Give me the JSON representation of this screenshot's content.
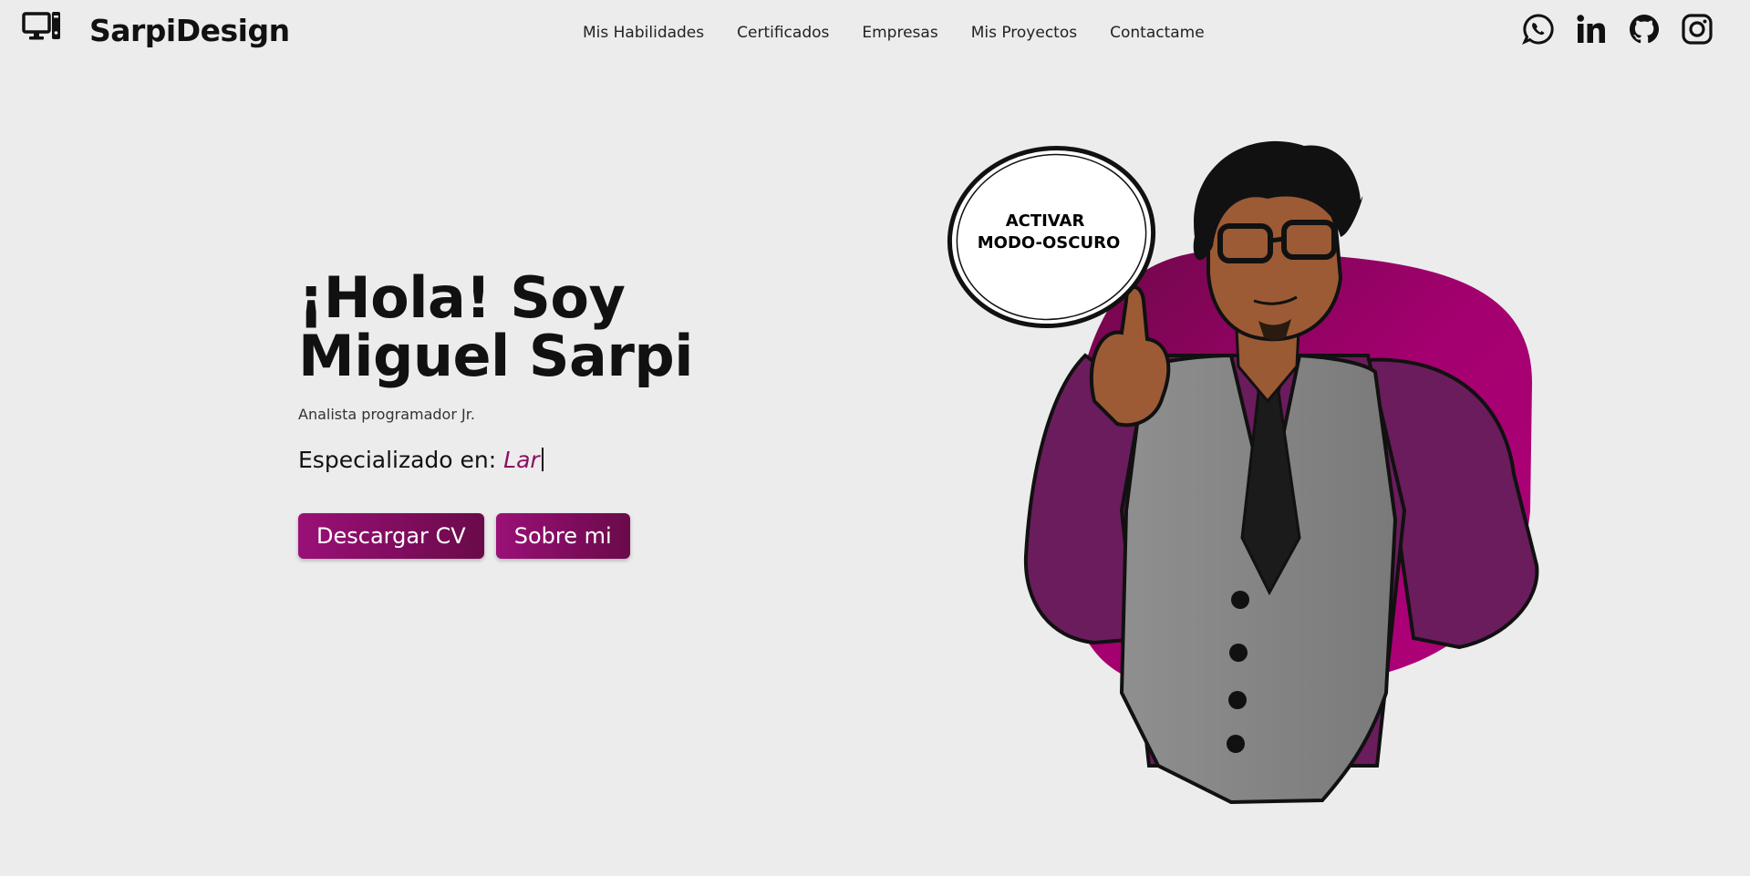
{
  "header": {
    "logo_icon": "desktop-computer-icon",
    "brand": "SarpiDesign",
    "nav": [
      {
        "label": "Mis Habilidades"
      },
      {
        "label": "Certificados"
      },
      {
        "label": "Empresas"
      },
      {
        "label": "Mis Proyectos"
      },
      {
        "label": "Contactame"
      }
    ],
    "socials": [
      "whatsapp-icon",
      "linkedin-icon",
      "github-icon",
      "instagram-icon"
    ]
  },
  "hero": {
    "title_line1": "¡Hola! Soy",
    "title_line2": "Miguel Sarpi",
    "subtitle": "Analista programador Jr.",
    "spec_label": "Especializado en:",
    "spec_typed": "Lar",
    "buttons": {
      "download_cv": "Descargar CV",
      "about_me": "Sobre mi"
    }
  },
  "illustration": {
    "bubble_line1": "ACTIVAR",
    "bubble_line2": "MODO-OSCURO"
  },
  "colors": {
    "accent": "#8c1063",
    "background": "#ececec",
    "blob": "#a4006f"
  }
}
